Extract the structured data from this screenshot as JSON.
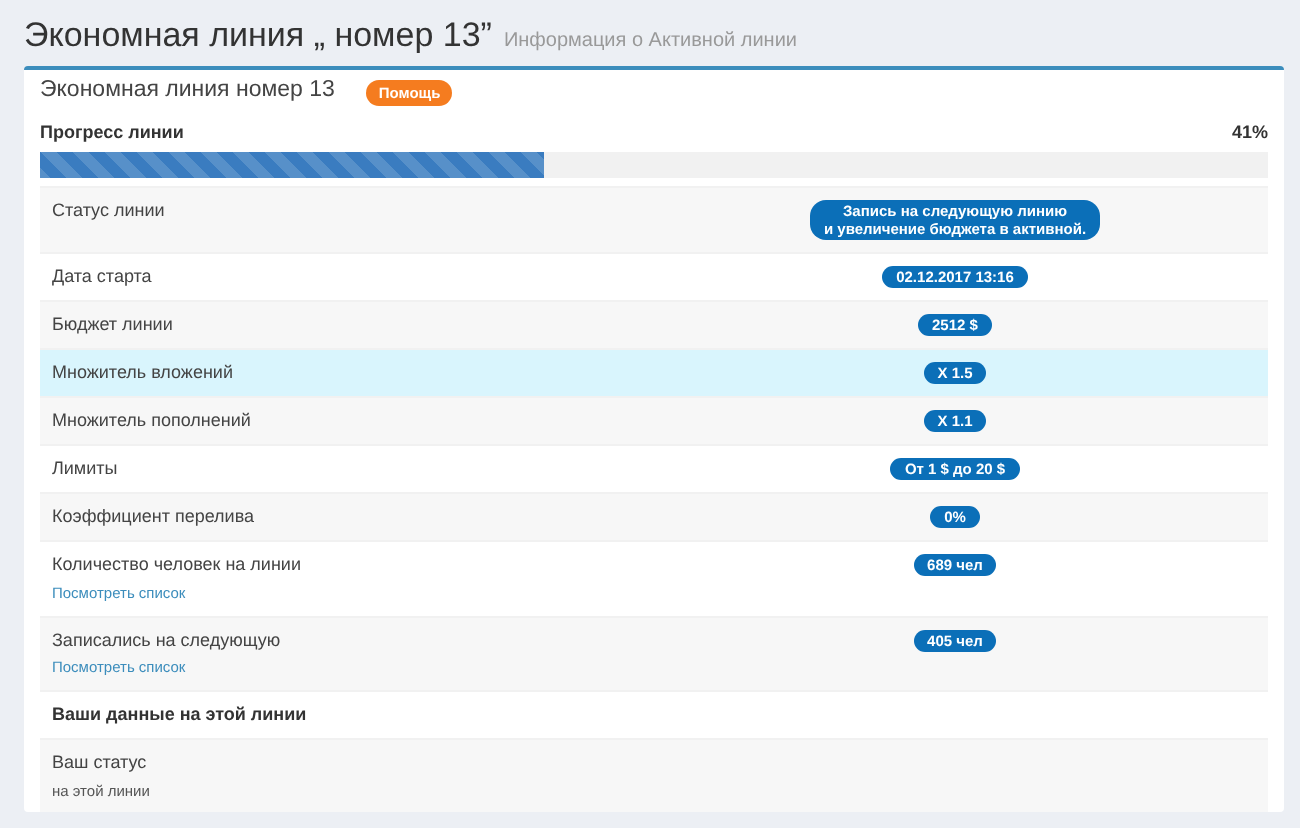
{
  "page": {
    "title": "Экономная линия „ номер 13”",
    "subtitle": "Информация о Активной линии"
  },
  "card": {
    "title": "Экономная линия номер 13",
    "help_badge": "Помощь",
    "progress": {
      "label": "Прогресс линии",
      "reading": "41%",
      "level": 0.41
    },
    "rows": [
      {
        "kind": "value",
        "label": "Статус линии",
        "value": "Запись на следующую линию\nи увеличение бюджета в активной.",
        "highlighted": false
      },
      {
        "kind": "value",
        "label": "Дата старта",
        "value": "02.12.2017 13:16",
        "highlighted": false
      },
      {
        "kind": "value",
        "label": "Бюджет линии",
        "value": "2512 $",
        "highlighted": false
      },
      {
        "kind": "value",
        "label": "Множитель вложений",
        "value": "X 1.5",
        "highlighted": true
      },
      {
        "kind": "value",
        "label": "Множитель пополнений",
        "value": "X 1.1",
        "highlighted": false
      },
      {
        "kind": "value",
        "label": "Лимиты",
        "value": "От 1 $ до 20 $",
        "highlighted": false
      },
      {
        "kind": "value",
        "label": "Коэффициент перелива",
        "value": "0%",
        "highlighted": false
      },
      {
        "kind": "value",
        "label": "Количество человек на линии",
        "link": "Посмотреть список",
        "value": "689 чел",
        "highlighted": false
      },
      {
        "kind": "value",
        "label": "Записались на следующую",
        "link": "Посмотреть список",
        "value": "405 чел",
        "highlighted": false
      },
      {
        "kind": "heading",
        "label": "Ваши данные на этой линии",
        "highlighted": false
      },
      {
        "kind": "value",
        "label": "Ваш статус",
        "sub": "на этой линии",
        "highlighted": false
      }
    ]
  }
}
